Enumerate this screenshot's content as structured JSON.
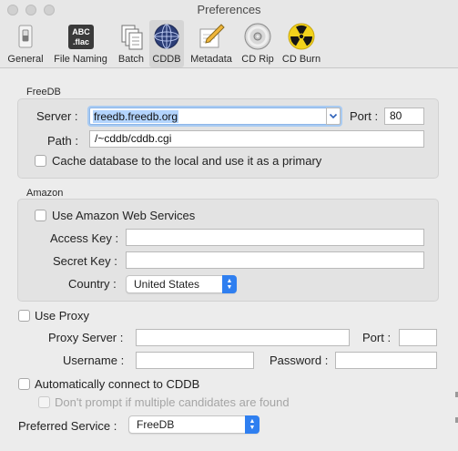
{
  "window": {
    "title": "Preferences"
  },
  "toolbar": {
    "items": [
      {
        "label": "General",
        "icon": "switch-icon"
      },
      {
        "label": "File Naming",
        "icon": "abc-flac-icon",
        "icon_text_top": "ABC",
        "icon_text_bottom": ".flac"
      },
      {
        "label": "Batch",
        "icon": "documents-icon"
      },
      {
        "label": "CDDB",
        "icon": "globe-icon",
        "selected": true
      },
      {
        "label": "Metadata",
        "icon": "pencil-note-icon"
      },
      {
        "label": "CD Rip",
        "icon": "cd-icon"
      },
      {
        "label": "CD Burn",
        "icon": "radiation-icon"
      }
    ]
  },
  "freedb": {
    "title": "FreeDB",
    "server_label": "Server :",
    "server_value": "freedb.freedb.org",
    "port_label": "Port :",
    "port_value": "80",
    "path_label": "Path :",
    "path_value": "/~cddb/cddb.cgi",
    "cache_label": "Cache database to the local and use it as a primary"
  },
  "amazon": {
    "title": "Amazon",
    "use_label": "Use Amazon Web Services",
    "access_key_label": "Access Key :",
    "access_key_value": "",
    "secret_key_label": "Secret Key :",
    "secret_key_value": "",
    "country_label": "Country :",
    "country_value": "United States"
  },
  "proxy": {
    "use_label": "Use Proxy",
    "server_label": "Proxy Server :",
    "server_value": "",
    "port_label": "Port :",
    "port_value": "",
    "username_label": "Username :",
    "username_value": "",
    "password_label": "Password :",
    "password_value": ""
  },
  "auto": {
    "connect_label": "Automatically connect to CDDB",
    "dont_prompt_label": "Don't prompt if multiple candidates are found"
  },
  "preferred": {
    "label": "Preferred Service :",
    "value": "FreeDB"
  },
  "colors": {
    "accent": "#2f7ff0",
    "selection": "#b3d4fd"
  }
}
